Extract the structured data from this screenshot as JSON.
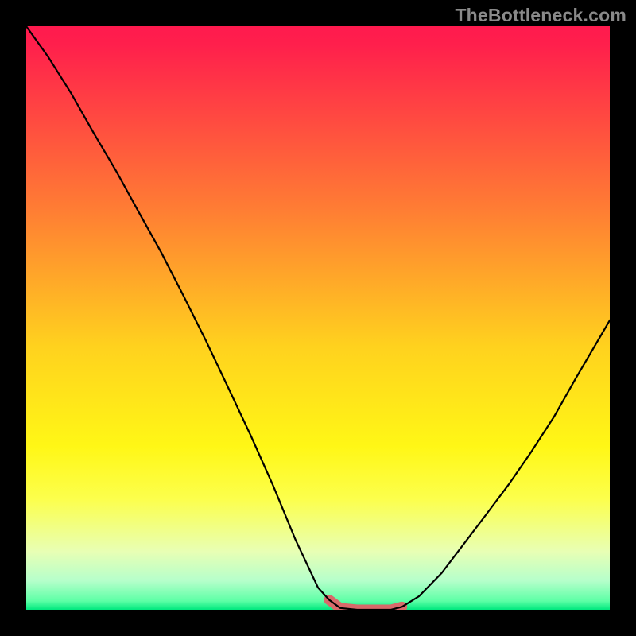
{
  "watermark": {
    "text": "TheBottleneck.com"
  },
  "chart_data": {
    "type": "line",
    "title": "",
    "xlabel": "",
    "ylabel": "",
    "xlim": [
      0,
      100
    ],
    "ylim": [
      0,
      100
    ],
    "grid": false,
    "legend": false,
    "x": [
      0,
      3.8,
      7.7,
      11.5,
      15.4,
      19.2,
      23.1,
      26.9,
      30.8,
      34.6,
      38.5,
      42.3,
      46.1,
      50,
      51.9,
      53.8,
      56.7,
      59.6,
      62.5,
      64.4,
      67.3,
      71.2,
      75,
      78.8,
      82.7,
      86.5,
      90.4,
      94.2,
      100
    ],
    "values": [
      100,
      94.7,
      88.5,
      81.8,
      75.2,
      68.3,
      61.3,
      53.9,
      46.1,
      38.1,
      29.8,
      21.3,
      12.1,
      3.8,
      1.7,
      0.3,
      0,
      0,
      0,
      0.5,
      2.3,
      6.3,
      11.3,
      16.3,
      21.5,
      27,
      33,
      39.7,
      49.6
    ],
    "gradient_stops": [
      {
        "pct": 0.0,
        "color": "#ff1a4e"
      },
      {
        "pct": 3.0,
        "color": "#ff1f4c"
      },
      {
        "pct": 32.0,
        "color": "#ff7f33"
      },
      {
        "pct": 55.0,
        "color": "#ffd21e"
      },
      {
        "pct": 72.0,
        "color": "#fff716"
      },
      {
        "pct": 81.0,
        "color": "#fcff4c"
      },
      {
        "pct": 90.0,
        "color": "#e8ffb4"
      },
      {
        "pct": 95.0,
        "color": "#b6ffcb"
      },
      {
        "pct": 98.5,
        "color": "#5dffa6"
      },
      {
        "pct": 100.0,
        "color": "#00e87e"
      }
    ],
    "flat_region": {
      "x_start": 51,
      "x_end": 65,
      "color": "#d86a6a",
      "stroke_width": 13
    },
    "curve_color": "#000000"
  }
}
